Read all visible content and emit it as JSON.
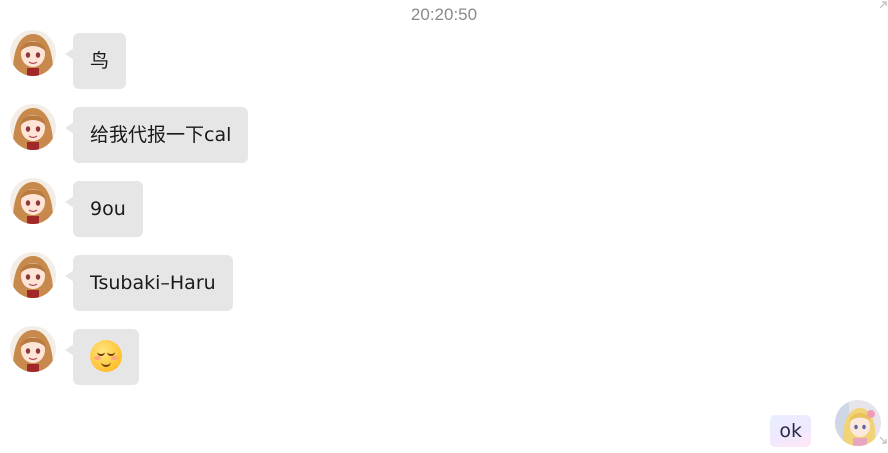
{
  "chat": {
    "timestamp": "20:20:50",
    "incoming": [
      {
        "text": "鸟",
        "type": "text"
      },
      {
        "text": "给我代报一下cal",
        "type": "text"
      },
      {
        "text": "9ou",
        "type": "text"
      },
      {
        "text": "Tsubaki–Haru",
        "type": "text"
      },
      {
        "text": "",
        "type": "emoji",
        "emoji": "smiling-blush-emoji"
      }
    ],
    "outgoing": [
      {
        "text": "ok",
        "type": "text"
      }
    ]
  },
  "colors": {
    "incoming_bubble": "#e6e6e6",
    "timestamp_text": "#8a8a8a",
    "outgoing_bubble_gradient": [
      "#e8f0ff",
      "#efe8ff",
      "#ffe8f2"
    ]
  },
  "icons": {
    "corner_top": "resize-arrow-icon",
    "corner_bottom": "resize-arrow-icon"
  }
}
